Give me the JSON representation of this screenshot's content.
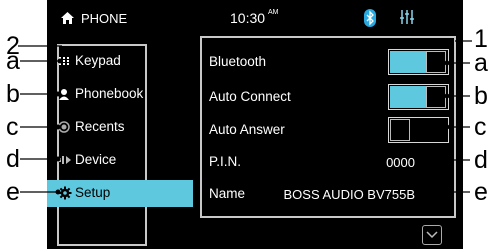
{
  "status": {
    "title": "PHONE",
    "time": "10:30",
    "ampm": "AM"
  },
  "menu": {
    "items": [
      {
        "label": "Keypad",
        "icon": "keypad-icon",
        "active": false
      },
      {
        "label": "Phonebook",
        "icon": "person-icon",
        "active": false
      },
      {
        "label": "Recents",
        "icon": "recents-icon",
        "active": false
      },
      {
        "label": "Device",
        "icon": "device-icon",
        "active": false
      },
      {
        "label": "Setup",
        "icon": "gear-icon",
        "active": true
      }
    ]
  },
  "settings": {
    "bluetooth": {
      "label": "Bluetooth",
      "state": "on"
    },
    "auto_connect": {
      "label": "Auto Connect",
      "state": "on"
    },
    "auto_answer": {
      "label": "Auto Answer",
      "state": "off"
    },
    "pin": {
      "label": "P.I.N.",
      "value": "0000"
    },
    "name": {
      "label": "Name",
      "value": "BOSS AUDIO BV755B"
    }
  },
  "callouts": {
    "left_group": "2",
    "left_a": "a",
    "left_b": "b",
    "left_c": "c",
    "left_d": "d",
    "left_e": "e",
    "right_group": "1",
    "right_a": "a",
    "right_b": "b",
    "right_c": "c",
    "right_d": "d",
    "right_e": "e"
  },
  "colors": {
    "accent": "#5ec8de",
    "screen_bg": "#000000",
    "frame": "#cccccc"
  }
}
